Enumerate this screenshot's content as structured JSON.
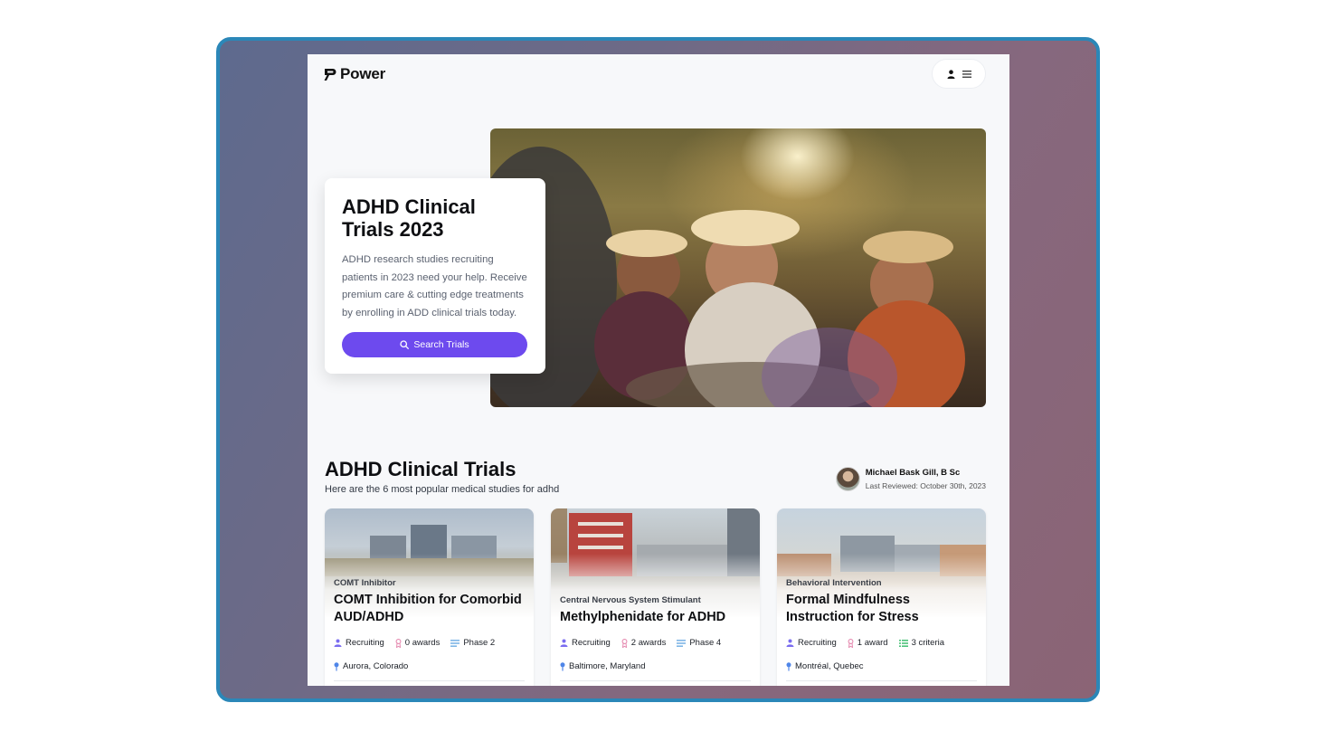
{
  "brand": {
    "name": "Power"
  },
  "hero": {
    "title": "ADHD Clinical Trials 2023",
    "description": "ADHD research studies recruiting patients in 2023 need your help. Receive premium care & cutting edge treatments by enrolling in ADD clinical trials today.",
    "search_label": "Search Trials"
  },
  "section": {
    "title": "ADHD Clinical Trials",
    "subtitle": "Here are the 6 most popular medical studies for adhd"
  },
  "reviewer": {
    "name": "Michael Bask Gill, B Sc",
    "last_reviewed": "Last Reviewed: October 30th, 2023"
  },
  "cards": [
    {
      "category": "COMT Inhibitor",
      "title": "COMT Inhibition for Comorbid AUD/ADHD",
      "status": "Recruiting",
      "awards": "0 awards",
      "extra": "Phase 2",
      "location": "Aurora, Colorado"
    },
    {
      "category": "Central Nervous System Stimulant",
      "title": "Methylphenidate for ADHD",
      "status": "Recruiting",
      "awards": "2 awards",
      "extra": "Phase 4",
      "location": "Baltimore, Maryland"
    },
    {
      "category": "Behavioral Intervention",
      "title": "Formal Mindfulness Instruction for Stress",
      "status": "Recruiting",
      "awards": "1 award",
      "extra": "3 criteria",
      "location": "Montréal, Quebec"
    }
  ],
  "colors": {
    "accent": "#6d4aee",
    "frame": "#2b87b8"
  },
  "icons": [
    "logo-mark-icon",
    "user-icon",
    "menu-icon",
    "search-icon",
    "person-icon",
    "ribbon-icon",
    "phase-icon",
    "list-icon",
    "pin-icon"
  ]
}
